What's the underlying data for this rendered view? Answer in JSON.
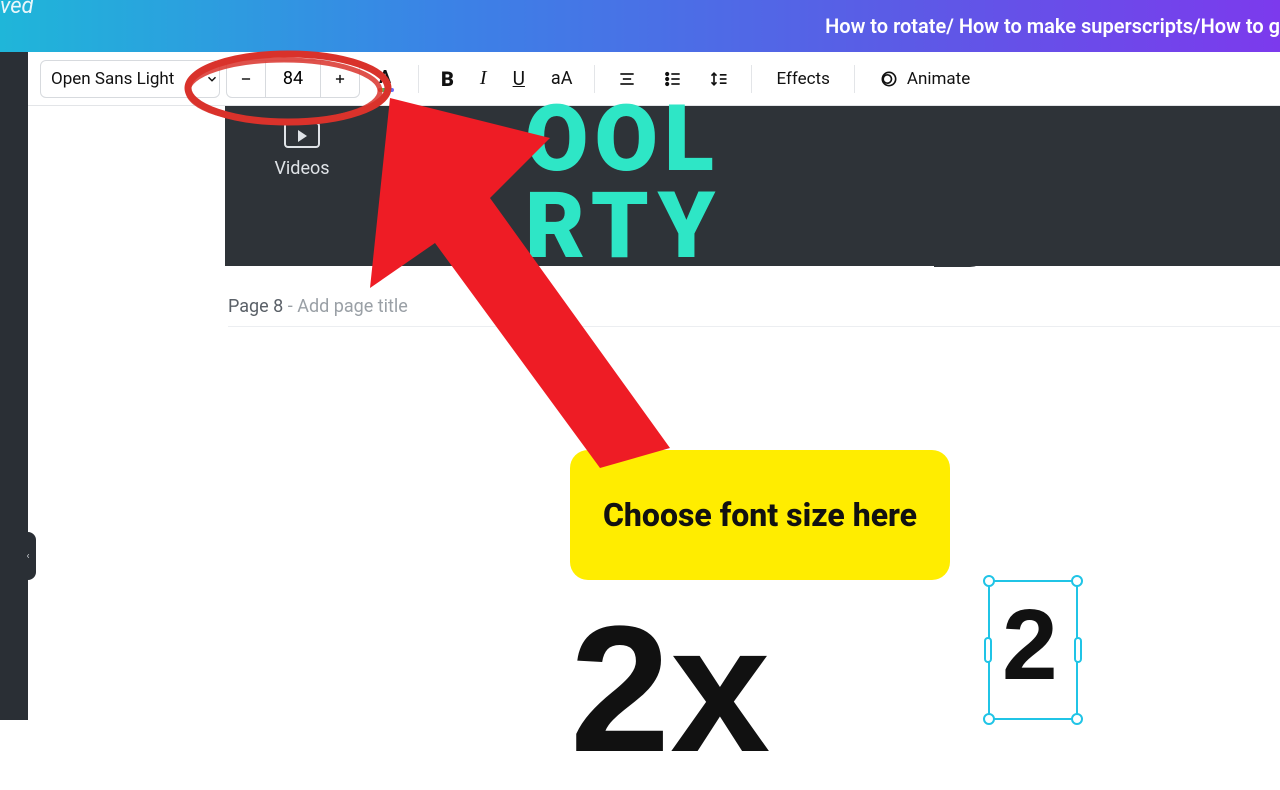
{
  "header": {
    "left_text": "ved",
    "right_text": "How to rotate/ How to make superscripts/How to g"
  },
  "toolbar": {
    "font_name": "Open Sans Light",
    "font_size": "84",
    "effects_label": "Effects",
    "animate_label": "Animate",
    "case_label": "aA"
  },
  "side_panel": {
    "videos_label": "Videos"
  },
  "preview": {
    "neon_line1": "OOL",
    "neon_line2": "RTY"
  },
  "page": {
    "label_prefix": "Page 8",
    "label_sep": " - ",
    "title_placeholder": "Add page title"
  },
  "annotation": {
    "callout_text": "Choose font size here"
  },
  "canvas": {
    "math_text": "2x",
    "superscript_text": "2"
  }
}
